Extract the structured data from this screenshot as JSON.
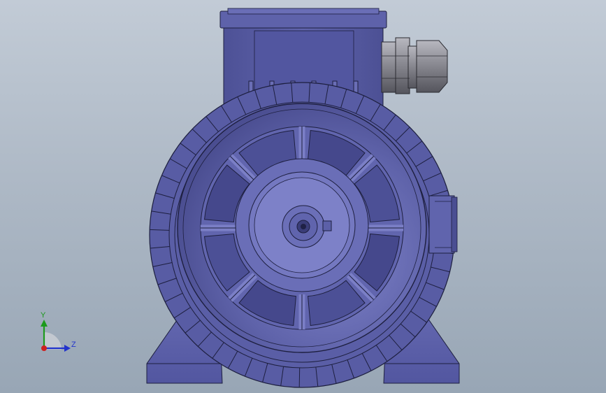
{
  "colors": {
    "background_top": "#c2cbd6",
    "background_bottom": "#98a6b5",
    "motor_body": "#5b5fa6",
    "motor_dark": "#3e417f",
    "motor_light": "#7c80c4",
    "edge": "#1d1f3f",
    "cable_gland": "#8d8d95",
    "axis_x": "#cc2020",
    "axis_y": "#1c9a1c",
    "axis_z": "#2233cc"
  },
  "triad": {
    "y_label": "Y",
    "z_label": "Z",
    "x_icon": "x-axis-arrow-icon",
    "y_icon": "y-axis-arrow-icon",
    "z_icon": "z-axis-arrow-icon"
  },
  "model": {
    "icon": "electric-motor-front-view",
    "fan_cover_spokes": 8
  }
}
